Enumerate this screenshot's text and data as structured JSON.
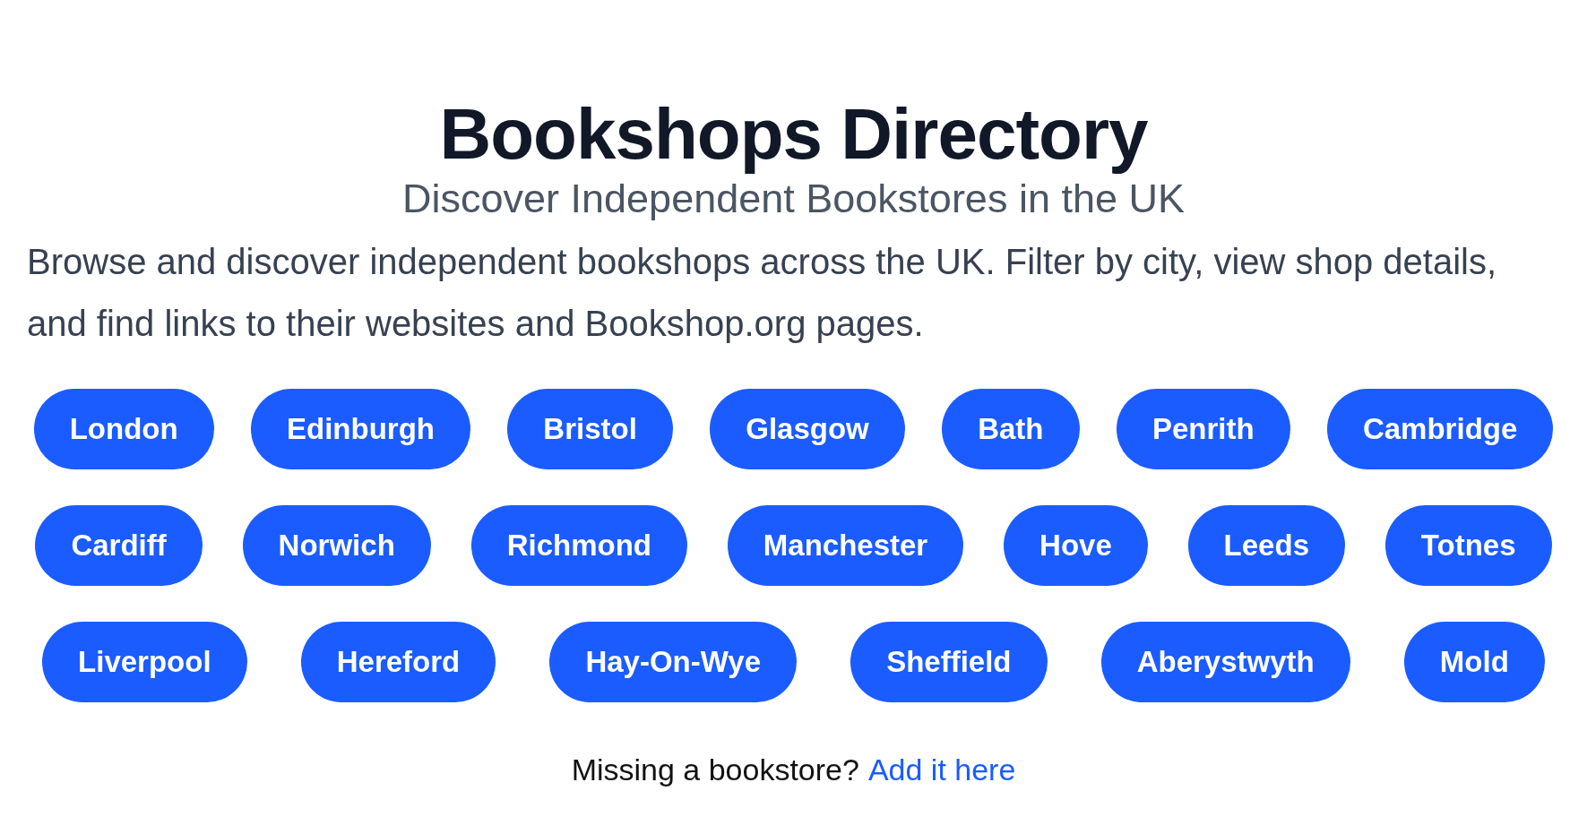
{
  "header": {
    "title": "Bookshops Directory",
    "subtitle": "Discover Independent Bookstores in the UK"
  },
  "intro": "Browse and discover independent bookshops across the UK. Filter by city, view shop details, and find links to their websites and Bookshop.org pages.",
  "cities": [
    "London",
    "Edinburgh",
    "Bristol",
    "Glasgow",
    "Bath",
    "Penrith",
    "Cambridge",
    "Cardiff",
    "Norwich",
    "Richmond",
    "Manchester",
    "Hove",
    "Leeds",
    "Totnes",
    "Liverpool",
    "Hereford",
    "Hay-On-Wye",
    "Sheffield",
    "Aberystwyth",
    "Mold"
  ],
  "footer": {
    "text": "Missing a bookstore?",
    "link": "Add it here"
  }
}
